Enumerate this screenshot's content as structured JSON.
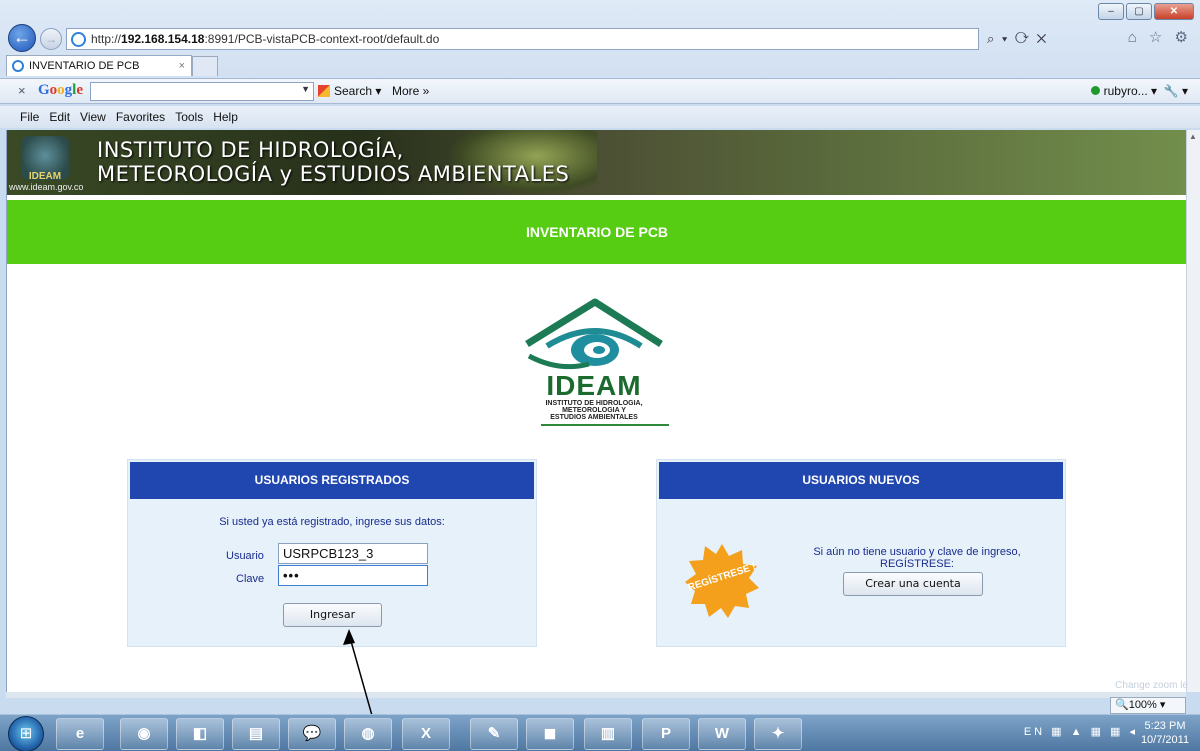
{
  "browser": {
    "window_controls": [
      "–",
      "▢",
      "✕"
    ],
    "address": {
      "prefix": "http://",
      "host": "192.168.154.18",
      "rest": ":8991/PCB-vistaPCB-context-root/default.do"
    },
    "address_tools": "⌕ ▾ ⟳ ✕",
    "fav_icons": "⌂ ☆ ⚙",
    "tab": {
      "label": "INVENTARIO DE PCB",
      "close": "×"
    },
    "google_bar": {
      "close": "×",
      "logo": "Google",
      "search_label": "Search ▾",
      "more_label": "More »",
      "user_label": "rubyro... ▾",
      "wrench": "🔧 ▾"
    },
    "menu": [
      "File",
      "Edit",
      "View",
      "Favorites",
      "Tools",
      "Help"
    ]
  },
  "page": {
    "banner": {
      "title_line1": "INSTITUTO DE HIDROLOGÍA,",
      "title_line2": "METEOROLOGÍA y ESTUDIOS AMBIENTALES",
      "logo_text": "IDEAM",
      "url": "www.ideam.gov.co"
    },
    "header_title": "INVENTARIO DE PCB",
    "logo": {
      "word": "IDEAM",
      "sub1": "INSTITUTO DE HIDROLOGIA,",
      "sub2": "METEOROLOGIA Y",
      "sub3": "ESTUDIOS AMBIENTALES"
    },
    "registered": {
      "heading": "USUARIOS REGISTRADOS",
      "intro": "Si usted ya está registrado, ingrese sus datos:",
      "user_label": "Usuario",
      "user_value": "USRPCB123_3",
      "pass_label": "Clave",
      "pass_value": "•••",
      "submit_label": "Ingresar"
    },
    "new_users": {
      "heading": "USUARIOS NUEVOS",
      "intro": "Si aún no tiene usuario y clave de ingreso, REGÍSTRESE:",
      "badge": "REGÍSTRESE !",
      "button_label": "Crear una cuenta"
    }
  },
  "status": {
    "zoom_tooltip": "Change zoom le",
    "zoom_label": "🔍100%  ▾"
  },
  "taskbar": {
    "tray_lang": "EN ▦ ▲ ▦ ▦ ◂",
    "time": "5:23 PM",
    "date": "10/7/2011"
  },
  "colors": {
    "header_blue": "#2046b0",
    "header_green": "#56cc12",
    "panel_bg": "#e6f1fa"
  }
}
